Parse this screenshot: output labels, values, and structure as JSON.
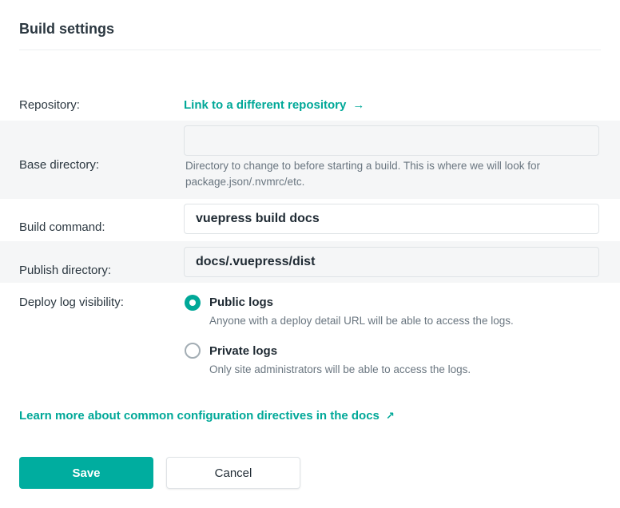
{
  "panel": {
    "title": "Build settings"
  },
  "repository": {
    "label": "Repository:",
    "link_text": "Link to a different repository",
    "link_arrow": "→"
  },
  "base_directory": {
    "label": "Base directory:",
    "value": "",
    "help_line1": "Directory to change to before starting a build. This is where we will look for",
    "help_line2": "package.json/.nvmrc/etc."
  },
  "build_command": {
    "label": "Build command:",
    "value": "vuepress build docs"
  },
  "publish_directory": {
    "label": "Publish directory:",
    "value": "docs/.vuepress/dist"
  },
  "deploy_log_visibility": {
    "label": "Deploy log visibility:",
    "selected": "public",
    "options": [
      {
        "id": "public",
        "title": "Public logs",
        "description": "Anyone with a deploy detail URL will be able to access the logs."
      },
      {
        "id": "private",
        "title": "Private logs",
        "description": "Only site administrators will be able to access the logs."
      }
    ]
  },
  "docs_link": {
    "text": "Learn more about common configuration directives in the docs",
    "arrow": "↗"
  },
  "actions": {
    "save_label": "Save",
    "cancel_label": "Cancel"
  },
  "colors": {
    "accent": "#00a898",
    "primary_button": "#00ad9f",
    "row_shade": "#f5f6f7",
    "text": "#2b3740",
    "muted_text": "#6a7680"
  }
}
